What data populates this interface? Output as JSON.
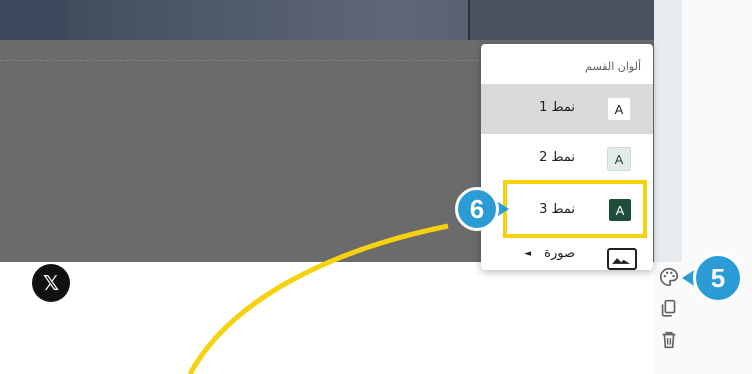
{
  "section": {
    "background_color": "#6b6b6b"
  },
  "social": {
    "x_logo_text": "𝕏"
  },
  "menu": {
    "header": "ألوان القسم",
    "items": [
      {
        "label": "نمط 1",
        "swatch_letter": "A",
        "swatch_bg": "#ffffff",
        "swatch_fg": "#202124",
        "selected": true
      },
      {
        "label": "نمط 2",
        "swatch_letter": "A",
        "swatch_bg": "#e3ece6",
        "swatch_fg": "#1e4d3a",
        "selected": false
      },
      {
        "label": "نمط 3",
        "swatch_letter": "A",
        "swatch_bg": "#1e4d3a",
        "swatch_fg": "#ffffff",
        "selected": false
      },
      {
        "label": "صورة",
        "arrow": "◄",
        "swatch_icon": "image-icon"
      }
    ]
  },
  "toolbar": {
    "icons": [
      "palette-icon",
      "copy-icon",
      "trash-icon"
    ]
  },
  "callouts": {
    "step6": "6",
    "step5": "5",
    "accent": "#2b9bd6",
    "highlight": "#f5d10e"
  }
}
